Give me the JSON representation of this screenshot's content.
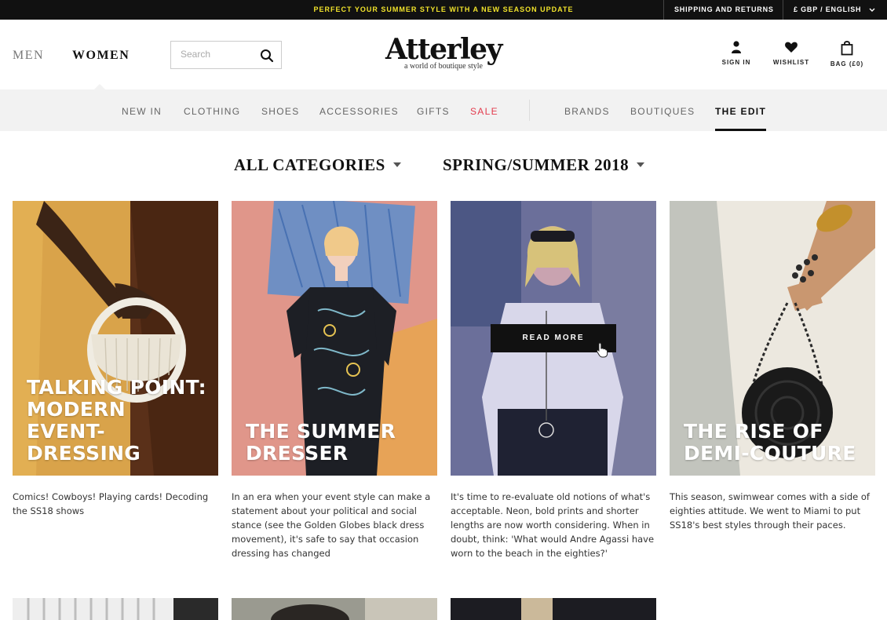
{
  "topbar": {
    "promo": "PERFECT YOUR SUMMER STYLE WITH A NEW SEASON UPDATE",
    "shipping": "SHIPPING AND RETURNS",
    "locale": "£ GBP / ENGLISH"
  },
  "header": {
    "men": "MEN",
    "women": "WOMEN",
    "search": {
      "placeholder": "Search",
      "value": ""
    },
    "logo": "Atterley",
    "tagline": "a world of boutique style",
    "sign_in": "SIGN IN",
    "wishlist": "WISHLIST",
    "bag": "BAG (£0)"
  },
  "nav": {
    "items": [
      "NEW IN",
      "CLOTHING",
      "SHOES",
      "ACCESSORIES",
      "GIFTS",
      "SALE",
      "BRANDS",
      "BOUTIQUES",
      "THE EDIT"
    ],
    "sale_color": "#e33a4c",
    "active": "THE EDIT"
  },
  "filters": {
    "category": "ALL CATEGORIES",
    "season": "SPRING/SUMMER 2018"
  },
  "cards": [
    {
      "title": "TALKING POINT: MODERN EVENT-DRESSING",
      "desc": "Comics! Cowboys! Playing cards! Decoding the SS18 shows"
    },
    {
      "title": "THE SUMMER DRESSER",
      "desc": "In an era when your event style can make a statement about your political and social stance (see the Golden Globes black dress movement), it's safe to say that occasion dressing has changed"
    },
    {
      "title": "",
      "desc": "It's time to re-evaluate old notions of what's acceptable. Neon, bold prints and shorter lengths are now worth considering. When in doubt, think: 'What would Andre Agassi have worn to the beach in the eighties?'",
      "button": "READ MORE"
    },
    {
      "title": "THE RISE OF DEMI-COUTURE",
      "desc": "This season, swimwear comes with a side of eighties attitude. We went to Miami to put SS18's best styles through their paces."
    }
  ],
  "icons": [
    "search-icon",
    "user-icon",
    "heart-icon",
    "bag-icon",
    "chevron-down-icon",
    "pointer-cursor-icon"
  ]
}
